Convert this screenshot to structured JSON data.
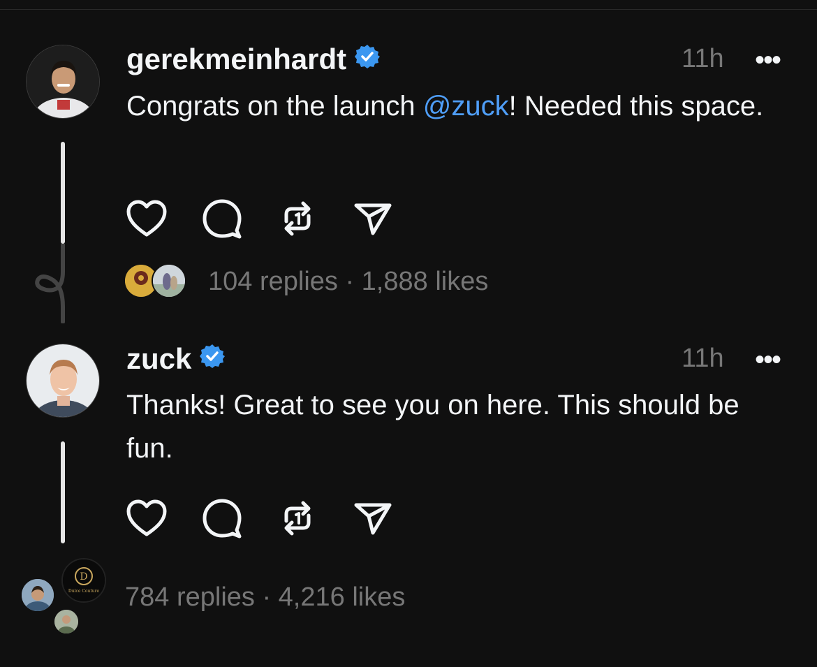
{
  "posts": [
    {
      "username": "gerekmeinhardt",
      "time": "11h",
      "more": "•••",
      "text_before": "Congrats on the launch ",
      "mention": "@zuck",
      "text_after": "! Needed this space.",
      "replies_likes": "104 replies · 1,888 likes"
    },
    {
      "username": "zuck",
      "time": "11h",
      "more": "•••",
      "text": "Thanks! Great to see you on here. This should be fun.",
      "replies_likes": "784 replies · 4,216 likes"
    }
  ],
  "icons": [
    "heart-icon",
    "comment-icon",
    "repost-icon",
    "send-icon",
    "verified-badge-icon",
    "more-icon"
  ],
  "colors": {
    "background": "#101010",
    "text": "#f3f5f7",
    "muted": "#777777",
    "mention": "#4f9ef8",
    "verified": "#3b97f0"
  }
}
